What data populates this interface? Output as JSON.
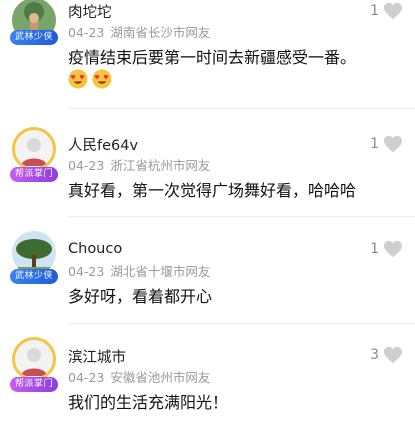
{
  "colors": {
    "badge_wulin": "#2f6fe8",
    "badge_bangpai": "#a64df0",
    "like_heart": "#cfcfcf",
    "meta_text": "#9a9a9a"
  },
  "comments": [
    {
      "user": "肉坨坨",
      "date": "04-23",
      "location": "湖南省长沙市网友",
      "text": "疫情结束后要第一时间去新疆感受一番。",
      "likes": "1",
      "badge": "武林少侠",
      "emojis": [
        "heart-eyes-emoji",
        "heart-eyes-emoji"
      ]
    },
    {
      "user": "人民fe64v",
      "date": "04-23",
      "location": "浙江省杭州市网友",
      "text": "真好看，第一次觉得广场舞好看，哈哈哈",
      "likes": "1",
      "badge": "帮派掌门"
    },
    {
      "user": "Chouco",
      "date": "04-23",
      "location": "湖北省十堰市网友",
      "text": "多好呀，看着都开心",
      "likes": "1",
      "badge": "武林少侠"
    },
    {
      "user": "滨江城市",
      "date": "04-23",
      "location": "安徽省池州市网友",
      "text": "我们的生活充满阳光！",
      "likes": "3",
      "badge": "帮派掌门"
    }
  ]
}
